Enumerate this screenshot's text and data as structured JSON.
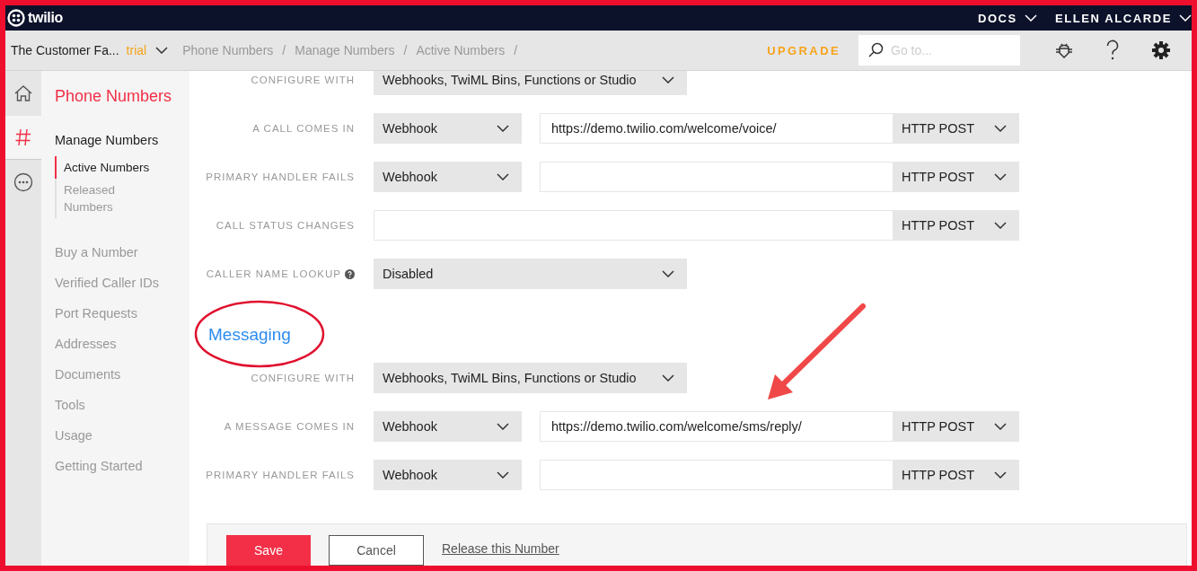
{
  "topbar": {
    "brand": "twilio",
    "links": [
      {
        "label": "DOCS"
      },
      {
        "label": "ELLEN ALCARDE"
      }
    ]
  },
  "subbar": {
    "account": "The Customer Fa...",
    "badge": "trial",
    "breadcrumbs": [
      "Phone Numbers",
      "Manage Numbers",
      "Active Numbers"
    ],
    "separator": "/",
    "upgrade": "UPGRADE",
    "search": {
      "placeholder": "Go to..."
    }
  },
  "rail": [
    {
      "kind": "home",
      "selected": false
    },
    {
      "kind": "hash",
      "selected": true
    },
    {
      "kind": "more",
      "selected": false
    }
  ],
  "sidebar": {
    "title": "Phone Numbers",
    "section": {
      "label": "Manage Numbers",
      "items": [
        {
          "label": "Active Numbers",
          "selected": true
        },
        {
          "label": "Released Numbers",
          "selected": false
        }
      ]
    },
    "items": [
      "Buy a Number",
      "Verified Caller IDs",
      "Port Requests",
      "Addresses",
      "Documents",
      "Tools",
      "Usage",
      "Getting Started"
    ]
  },
  "voice": {
    "rows": [
      {
        "kind": "select",
        "label": "CONFIGURE WITH",
        "value": "Webhooks, TwiML Bins, Functions or Studio"
      },
      {
        "kind": "webhook",
        "label": "A CALL COMES IN",
        "value": "Webhook",
        "url": "https://demo.twilio.com/welcome/voice/",
        "method": "HTTP POST"
      },
      {
        "kind": "webhook",
        "label": "PRIMARY HANDLER FAILS",
        "value": "Webhook",
        "method": "HTTP POST"
      },
      {
        "kind": "url",
        "label": "CALL STATUS CHANGES",
        "method": "HTTP POST"
      },
      {
        "kind": "select",
        "label": "CALLER NAME LOOKUP",
        "help": true,
        "value": "Disabled"
      }
    ]
  },
  "messaging": {
    "heading": "Messaging",
    "rows": [
      {
        "kind": "select",
        "label": "CONFIGURE WITH",
        "value": "Webhooks, TwiML Bins, Functions or Studio"
      },
      {
        "kind": "webhook",
        "label": "A MESSAGE COMES IN",
        "value": "Webhook",
        "url": "https://demo.twilio.com/welcome/sms/reply/",
        "method": "HTTP POST"
      },
      {
        "kind": "webhook",
        "label": "PRIMARY HANDLER FAILS",
        "value": "Webhook",
        "method": "HTTP POST"
      }
    ]
  },
  "footer": {
    "save": "Save",
    "cancel": "Cancel",
    "release": "Release this Number"
  }
}
